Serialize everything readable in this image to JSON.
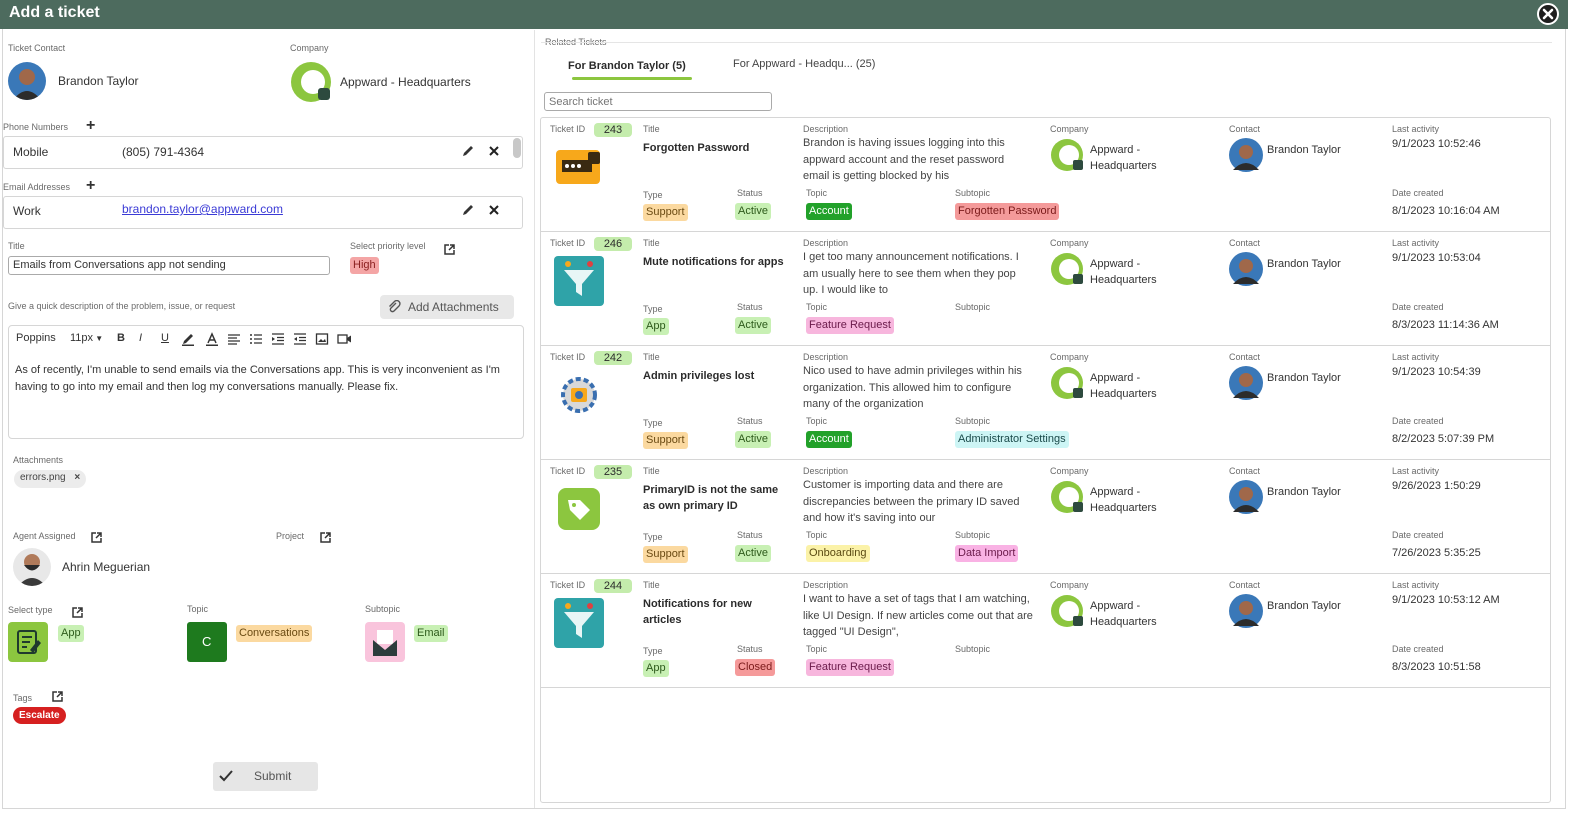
{
  "window": {
    "title": "Add a ticket"
  },
  "left": {
    "contact_label": "Ticket Contact",
    "contact_name": "Brandon Taylor",
    "company_label": "Company",
    "company_name": "Appward - Headquarters",
    "phone_label": "Phone Numbers",
    "phone_type": "Mobile",
    "phone_value": "(805) 791-4364",
    "email_label": "Email Addresses",
    "email_type": "Work",
    "email_value": "brandon.taylor@appward.com",
    "title_label": "Title",
    "title_value": "Emails from Conversations app not sending",
    "priority_label": "Select priority level",
    "priority_value": "High",
    "desc_label": "Give a quick description of the problem, issue, or request",
    "attach_button": "Add Attachments",
    "editor_font": "Poppins",
    "editor_size": "11px",
    "editor_text": "As of recently, I'm unable to send emails via the Conversations app. This is very inconvenient as I'm having to go into my email and then log my conversations manually. Please fix.",
    "attachments_label": "Attachments",
    "attachment_file": "errors.png",
    "agent_label": "Agent Assigned",
    "agent_name": "Ahrin Meguerian",
    "project_label": "Project",
    "type_label": "Select type",
    "type_value": "App",
    "topic_label": "Topic",
    "topic_value": "Conversations",
    "topic_initial": "C",
    "subtopic_label": "Subtopic",
    "subtopic_value": "Email",
    "tags_label": "Tags",
    "tag_value": "Escalate",
    "submit_label": "Submit"
  },
  "right": {
    "section_label": "Related Tickets",
    "tab_contact": "For Brandon Taylor (5)",
    "tab_company": "For Appward - Headqu... (25)",
    "search_placeholder": "Search ticket",
    "col_labels": {
      "ticket_id": "Ticket ID",
      "title": "Title",
      "description": "Description",
      "company": "Company",
      "contact": "Contact",
      "last_activity": "Last activity",
      "type": "Type",
      "status": "Status",
      "topic": "Topic",
      "subtopic": "Subtopic",
      "date_created": "Date created"
    },
    "tickets": [
      {
        "id": "243",
        "title": "Forgotten Password",
        "description": "Brandon is having issues logging into this appward account and the reset password email is getting blocked by his",
        "company_line1": "Appward -",
        "company_line2": "Headquarters",
        "contact": "Brandon Taylor",
        "last_activity": "9/1/2023 10:52:46",
        "type": "Support",
        "status": "Active",
        "topic": "Account",
        "subtopic": "Forgotten Password",
        "date_created": "8/1/2023 10:16:04 AM",
        "icon": "password-icon"
      },
      {
        "id": "246",
        "title": "Mute notifications for apps",
        "description": "I get too many announcement notifications. I am usually here to see them when they pop up. I would like to",
        "company_line1": "Appward -",
        "company_line2": "Headquarters",
        "contact": "Brandon Taylor",
        "last_activity": "9/1/2023 10:53:04",
        "type": "App",
        "status": "Active",
        "topic": "Feature Request",
        "subtopic": "",
        "date_created": "8/3/2023 11:14:36 AM",
        "icon": "funnel-icon"
      },
      {
        "id": "242",
        "title": "Admin privileges lost",
        "description": "Nico used to have admin privileges within his organization. This allowed him to configure many of the organization",
        "company_line1": "Appward -",
        "company_line2": "Headquarters",
        "contact": "Brandon Taylor",
        "last_activity": "9/1/2023 10:54:39",
        "type": "Support",
        "status": "Active",
        "topic": "Account",
        "subtopic": "Administrator Settings",
        "date_created": "8/2/2023 5:07:39 PM",
        "icon": "admin-gear-icon"
      },
      {
        "id": "235",
        "title": "PrimaryID is not the same as own primary ID",
        "description": "Customer is importing data and there are discrepancies between the primary ID saved and how it's saving into our",
        "company_line1": "Appward -",
        "company_line2": "Headquarters",
        "contact": "Brandon Taylor",
        "last_activity": "9/26/2023 1:50:29",
        "type": "Support",
        "status": "Active",
        "topic": "Onboarding",
        "subtopic": "Data Import",
        "date_created": "7/26/2023 5:35:25",
        "icon": "tag-icon"
      },
      {
        "id": "244",
        "title": "Notifications for new articles",
        "description": "I want to have a set of tags that I am watching, like UI Design. If new articles come out that are tagged \"UI Design\",",
        "company_line1": "Appward -",
        "company_line2": "Headquarters",
        "contact": "Brandon Taylor",
        "last_activity": "9/1/2023 10:53:12 AM",
        "type": "App",
        "status": "Closed",
        "topic": "Feature Request",
        "subtopic": "",
        "date_created": "8/3/2023 10:51:58",
        "icon": "funnel-icon"
      }
    ]
  },
  "colors": {
    "header_bg": "#4d6b5e",
    "accent_green": "#8cc63f",
    "support_bg": "#fbd9a0",
    "app_bg": "#c8f0b4",
    "active_bg": "#c8f0b4",
    "closed_bg": "#f59a9a",
    "account_bg": "#22a12a",
    "feature_bg": "#f7b6dd",
    "onboarding_bg": "#fbf2a8",
    "forgotten_bg": "#f49a9a",
    "admin_settings_bg": "#cdf5f5",
    "data_import_bg": "#f9b2e4",
    "high_bg": "#f4a5a5",
    "escalate_bg": "#d62020"
  }
}
